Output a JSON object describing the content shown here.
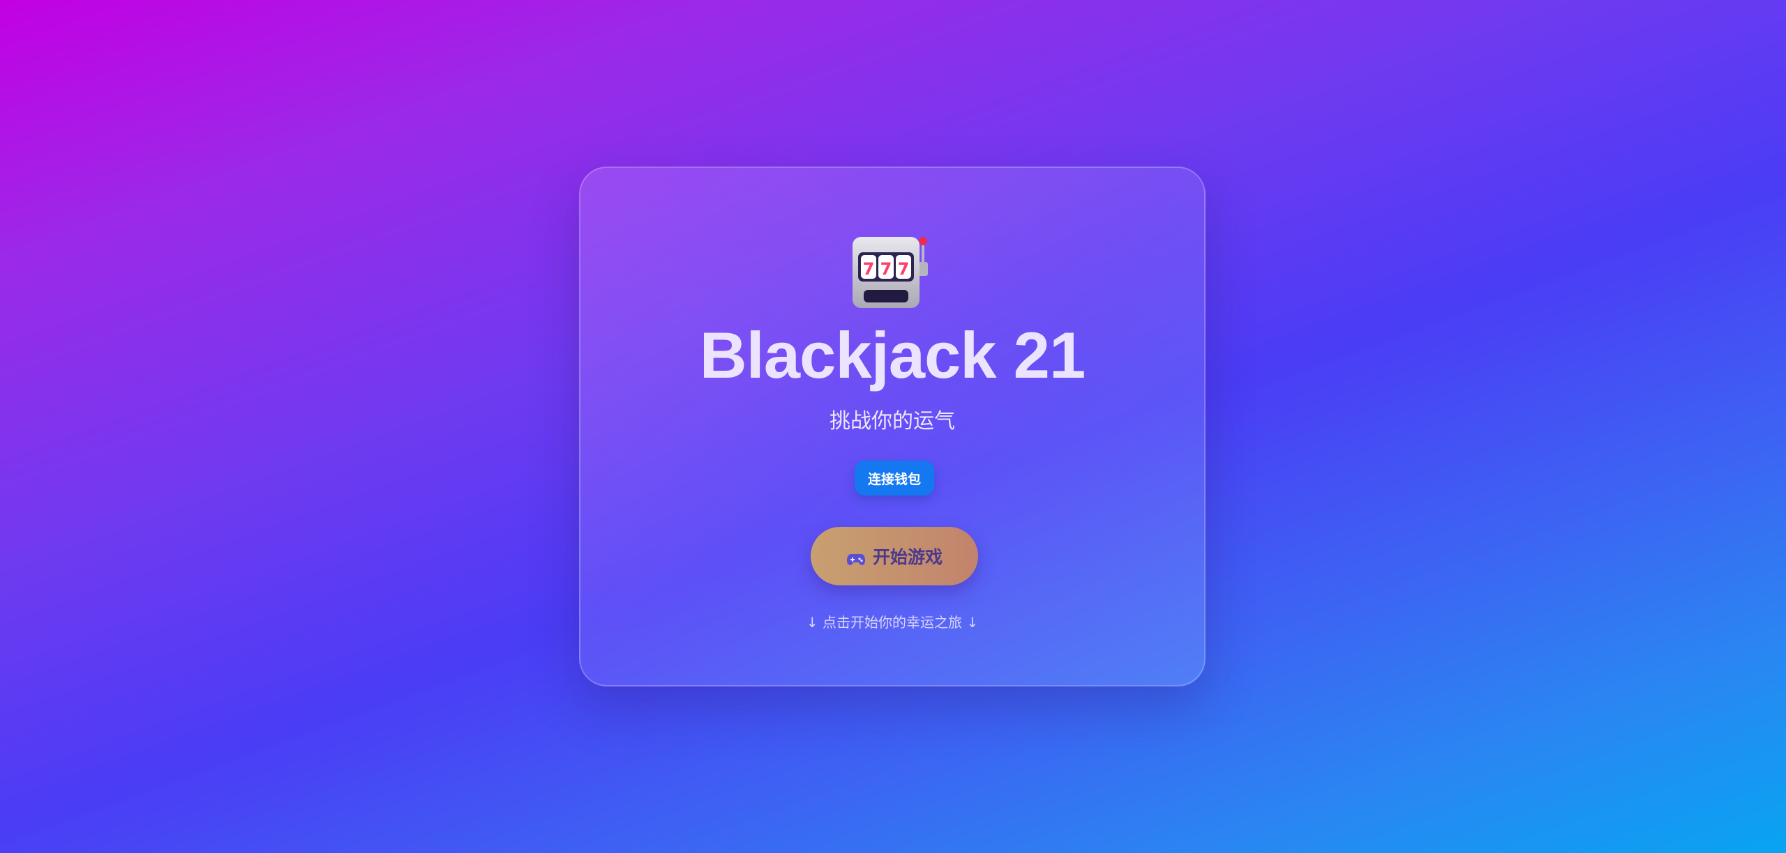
{
  "app": {
    "title": "Blackjack 21",
    "subtitle": "挑战你的运气",
    "icon": "slot-machine-icon"
  },
  "wallet": {
    "connect_label": "连接钱包"
  },
  "start": {
    "label": "开始游戏",
    "icon": "gamepad-icon"
  },
  "hint": {
    "text": "↓ 点击开始你的幸运之旅 ↓"
  },
  "colors": {
    "background_start": "#c300e3",
    "background_end": "#08a4f2",
    "wallet_button": "#1478f0",
    "start_button": "#c8a070",
    "start_text": "#4b3a8c"
  }
}
